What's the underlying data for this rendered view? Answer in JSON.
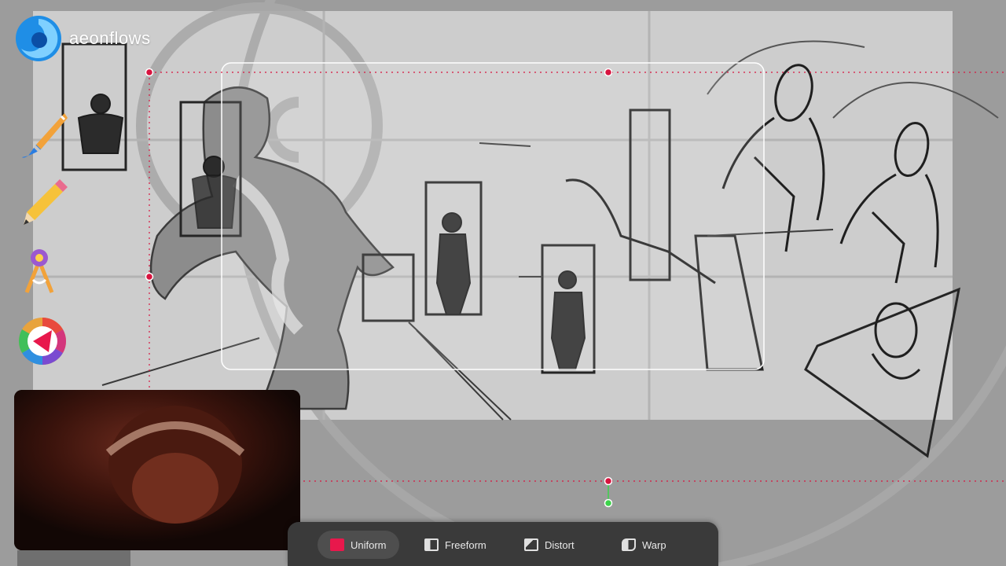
{
  "brand": {
    "name": "aeonflows"
  },
  "tools": [
    {
      "name": "brush-icon",
      "label": "Paint"
    },
    {
      "name": "pencil-icon",
      "label": "Sketch"
    },
    {
      "name": "compass-icon",
      "label": "Guides"
    },
    {
      "name": "color-wheel-icon",
      "label": "Color"
    }
  ],
  "transform_modes": [
    {
      "label": "Uniform",
      "icon": "uniform-icon",
      "active": true
    },
    {
      "label": "Freeform",
      "icon": "freeform-icon",
      "active": false
    },
    {
      "label": "Distort",
      "icon": "distort-icon",
      "active": false
    },
    {
      "label": "Warp",
      "icon": "warp-icon",
      "active": false
    }
  ],
  "colors": {
    "accent": "#e8184c",
    "handle": "#d8143f",
    "rotate_handle": "#3cd34a",
    "toolbar_bg": "#3a3a3a",
    "canvas_bg": "#cdcdcd"
  }
}
